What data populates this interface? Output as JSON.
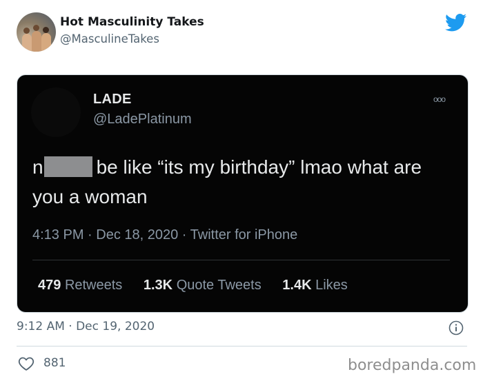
{
  "tweet": {
    "author_name": "Hot Masculinity Takes",
    "author_handle": "@MasculineTakes",
    "brand_color": "#1d9bf0",
    "timestamp": "9:12 AM · Dec 19, 2020",
    "like_count": "881",
    "icons": [
      "twitter-bird-icon",
      "info-icon",
      "heart-icon"
    ]
  },
  "embedded_tweet": {
    "author_name": "LADE",
    "author_handle": "@LadePlatinum",
    "more_glyph": "ooo",
    "text_prefix": "n",
    "text_body": "be like “its my birthday” lmao what are you a woman",
    "meta": "4:13 PM · Dec 18, 2020 · Twitter for iPhone",
    "stats": {
      "retweets_count": "479",
      "retweets_label": "Retweets",
      "quotes_count": "1.3K",
      "quotes_label": "Quote Tweets",
      "likes_count": "1.4K",
      "likes_label": "Likes"
    }
  },
  "watermark": "boredpanda.com"
}
